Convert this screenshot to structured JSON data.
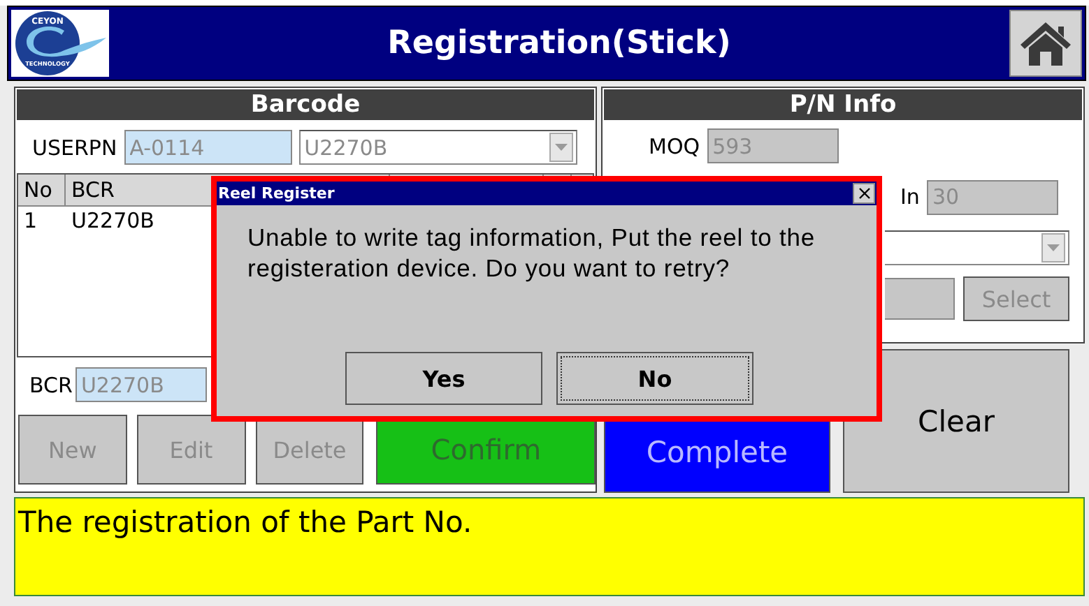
{
  "header": {
    "title": "Registration(Stick)",
    "logo": {
      "top_text": "CEYON",
      "bottom_text": "TECHNOLOGY"
    }
  },
  "barcode_panel": {
    "title": "Barcode",
    "userpn": {
      "label": "USERPN",
      "value": "A-0114",
      "disabled": false
    },
    "combo": {
      "value": "U2270B",
      "disabled": true
    },
    "table": {
      "columns": [
        "No",
        "BCR"
      ],
      "rows": [
        [
          "1",
          "U2270B"
        ]
      ]
    },
    "bcr": {
      "label": "BCR",
      "value": "U2270B",
      "disabled": false
    },
    "buttons": [
      {
        "label": "New",
        "kind": "plain",
        "disabled": true
      },
      {
        "label": "Edit",
        "kind": "plain",
        "disabled": true
      },
      {
        "label": "Delete",
        "kind": "plain",
        "disabled": true
      },
      {
        "label": "Confirm",
        "kind": "confirm",
        "disabled": true
      }
    ]
  },
  "pn_panel": {
    "title": "P/N Info",
    "moq": {
      "label": "MOQ",
      "value": "593",
      "disabled": true
    },
    "in": {
      "label": "In",
      "value": "30",
      "disabled": true
    },
    "select_button": {
      "label": "Select",
      "disabled": true
    }
  },
  "action_buttons": [
    {
      "label": "Complete",
      "kind": "complete",
      "disabled": true
    },
    {
      "label": "Clear",
      "kind": "plain",
      "disabled": false
    }
  ],
  "status": {
    "message": "The registration of the Part No."
  },
  "dialog": {
    "title": "Reel Register",
    "message": "Unable to write tag information, Put the reel to the registeration device. Do you want to retry?",
    "buttons": [
      {
        "label": "Yes",
        "focused": false
      },
      {
        "label": "No",
        "focused": true
      }
    ]
  }
}
